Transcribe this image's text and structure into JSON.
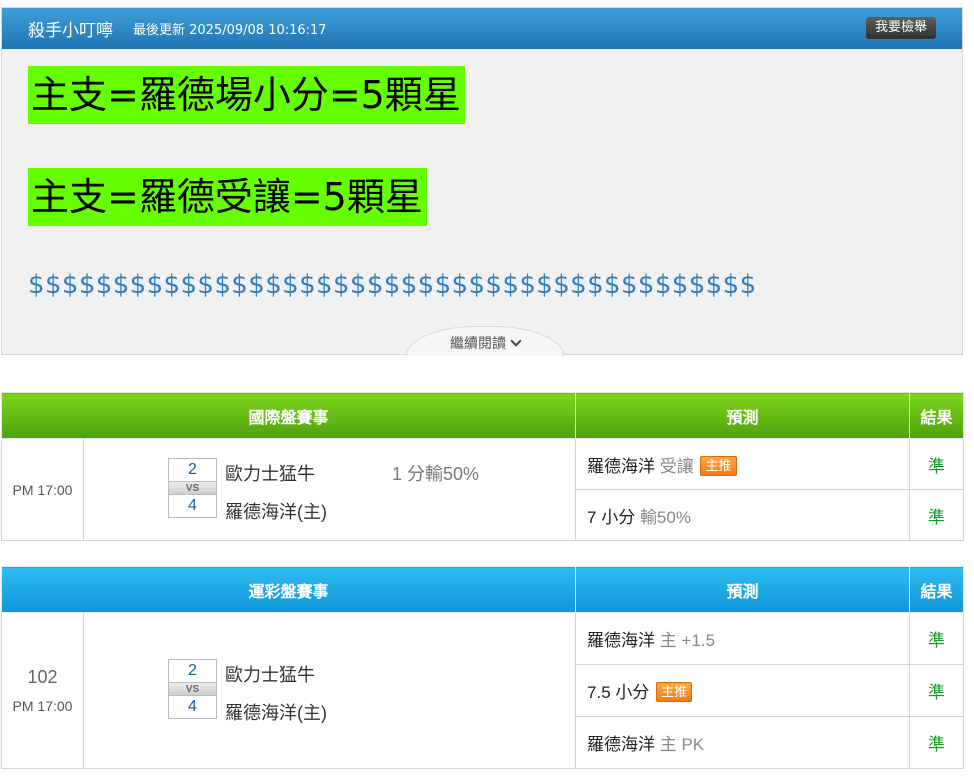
{
  "header": {
    "author": "殺手小叮嚀",
    "updated": "最後更新 2025/09/08 10:16:17",
    "check_button": "我要檢舉"
  },
  "content": {
    "line1": "主支=羅德場小分=5顆星",
    "line2": "主支=羅德受讓=5顆星",
    "dollars": "$$$$$$$$$$$$$$$$$$$$$$$$$$$$$$$$$$$$$$$$$$$",
    "read_more": "繼續閱讀"
  },
  "colors": {
    "highlight": "#66ff00",
    "header_blue": "#1f74b4",
    "green_header": "#5bb30f",
    "blue_header": "#1aa6e4",
    "result_green": "#119a24",
    "badge_orange": "#f07b10"
  },
  "international": {
    "headers": {
      "match": "國際盤賽事",
      "prediction": "預測",
      "result": "結果"
    },
    "time": "PM 17:00",
    "home_score": "2",
    "away_score": "4",
    "vs": "VS",
    "home_team": "歐力士猛牛",
    "away_team": "羅德海洋(主)",
    "aside": "1 分輸50%",
    "predictions": [
      {
        "main": "羅德海洋",
        "sub": "受讓",
        "badge": "主推",
        "result": "準"
      },
      {
        "main": "7 小分",
        "sub": "輸50%",
        "badge": "",
        "result": "準"
      }
    ]
  },
  "lottery": {
    "headers": {
      "match": "運彩盤賽事",
      "prediction": "預測",
      "result": "結果"
    },
    "number": "102",
    "time": "PM 17:00",
    "home_score": "2",
    "away_score": "4",
    "vs": "VS",
    "home_team": "歐力士猛牛",
    "away_team": "羅德海洋(主)",
    "predictions": [
      {
        "main": "羅德海洋",
        "sub": "主 +1.5",
        "badge": "",
        "result": "準"
      },
      {
        "main": "7.5 小分",
        "sub": "",
        "badge": "主推",
        "result": "準"
      },
      {
        "main": "羅德海洋",
        "sub": "主 PK",
        "badge": "",
        "result": "準"
      }
    ]
  }
}
